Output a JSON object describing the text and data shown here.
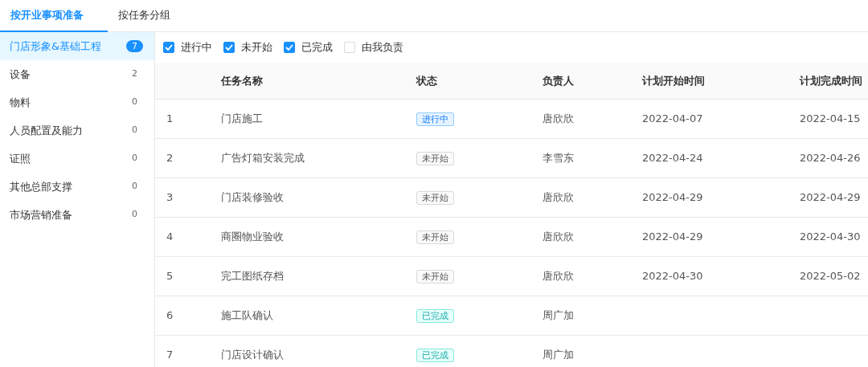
{
  "tabs": [
    {
      "label": "按开业事项准备",
      "selected": true
    },
    {
      "label": "按任务分组",
      "selected": false
    }
  ],
  "sidebar": {
    "items": [
      {
        "label": "门店形象&基础工程",
        "count": "7",
        "selected": true
      },
      {
        "label": "设备",
        "count": "2",
        "selected": false
      },
      {
        "label": "物料",
        "count": "0",
        "selected": false
      },
      {
        "label": "人员配置及能力",
        "count": "0",
        "selected": false
      },
      {
        "label": "证照",
        "count": "0",
        "selected": false
      },
      {
        "label": "其他总部支撑",
        "count": "0",
        "selected": false
      },
      {
        "label": "市场营销准备",
        "count": "0",
        "selected": false
      }
    ]
  },
  "filters": [
    {
      "label": "进行中",
      "checked": true
    },
    {
      "label": "未开始",
      "checked": true
    },
    {
      "label": "已完成",
      "checked": true
    },
    {
      "label": "由我负责",
      "checked": false
    }
  ],
  "table": {
    "columns": [
      "任务名称",
      "状态",
      "负责人",
      "计划开始时间",
      "计划完成时间"
    ],
    "rows": [
      {
        "index": "1",
        "name": "门店施工",
        "status": {
          "label": "进行中",
          "kind": "in_progress"
        },
        "owner": "唐欣欣",
        "start": "2022-04-07",
        "end": "2022-04-15"
      },
      {
        "index": "2",
        "name": "广告灯箱安装完成",
        "status": {
          "label": "未开始",
          "kind": "not_started"
        },
        "owner": "李雪东",
        "start": "2022-04-24",
        "end": "2022-04-26"
      },
      {
        "index": "3",
        "name": "门店装修验收",
        "status": {
          "label": "未开始",
          "kind": "not_started"
        },
        "owner": "唐欣欣",
        "start": "2022-04-29",
        "end": "2022-04-29"
      },
      {
        "index": "4",
        "name": "商圈物业验收",
        "status": {
          "label": "未开始",
          "kind": "not_started"
        },
        "owner": "唐欣欣",
        "start": "2022-04-29",
        "end": "2022-04-30"
      },
      {
        "index": "5",
        "name": "完工图纸存档",
        "status": {
          "label": "未开始",
          "kind": "not_started"
        },
        "owner": "唐欣欣",
        "start": "2022-04-30",
        "end": "2022-05-02"
      },
      {
        "index": "6",
        "name": "施工队确认",
        "status": {
          "label": "已完成",
          "kind": "done"
        },
        "owner": "周广加"
      },
      {
        "index": "7",
        "name": "门店设计确认",
        "status": {
          "label": "已完成",
          "kind": "done"
        },
        "owner": "周广加"
      }
    ]
  }
}
